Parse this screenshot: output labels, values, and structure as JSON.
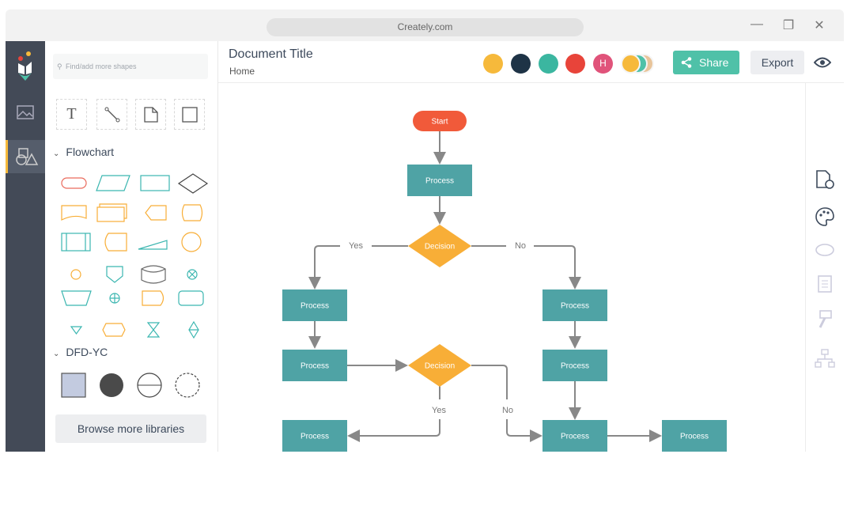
{
  "browser": {
    "url": "Creately.com"
  },
  "sidebar": {
    "search_placeholder": "Find/add more shapes",
    "sections": [
      {
        "label": "Flowchart"
      },
      {
        "label": "DFD-YC"
      }
    ],
    "browse_label": "Browse more libraries"
  },
  "header": {
    "title": "Document Title",
    "breadcrumb": "Home",
    "avatar_initial": "H",
    "share_label": "Share",
    "export_label": "Export"
  },
  "colors": {
    "accent": "#4fc1a8",
    "process": "#4fa3a5",
    "decision": "#f8ae37",
    "start": "#f15a3a",
    "rail": "#434a57"
  },
  "diagram": {
    "nodes": [
      {
        "id": "start",
        "type": "terminator",
        "label": "Start"
      },
      {
        "id": "p1",
        "type": "process",
        "label": "Process"
      },
      {
        "id": "d1",
        "type": "decision",
        "label": "Decision"
      },
      {
        "id": "p2",
        "type": "process",
        "label": "Process"
      },
      {
        "id": "p3",
        "type": "process",
        "label": "Process"
      },
      {
        "id": "p4",
        "type": "process",
        "label": "Process"
      },
      {
        "id": "d2",
        "type": "decision",
        "label": "Decision"
      },
      {
        "id": "p5",
        "type": "process",
        "label": "Process"
      },
      {
        "id": "p6",
        "type": "process",
        "label": "Process"
      },
      {
        "id": "p7",
        "type": "process",
        "label": "Process"
      },
      {
        "id": "p8",
        "type": "process",
        "label": "Process"
      }
    ],
    "edge_labels": {
      "yes": "Yes",
      "no": "No"
    }
  }
}
